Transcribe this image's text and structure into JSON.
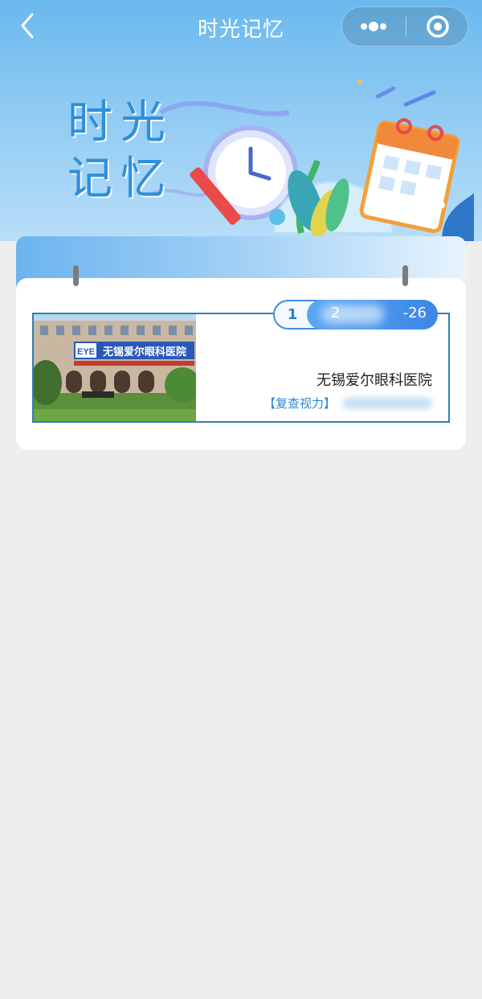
{
  "nav": {
    "title": "时光记忆",
    "back_icon": "chevron-left-icon",
    "more_icon": "more-dots-icon",
    "close_icon": "target-close-icon"
  },
  "hero": {
    "line1": "时光",
    "line2": "记忆"
  },
  "records": [
    {
      "index": "1",
      "date": "2",
      "date_end": "-26",
      "hospital": "无锡爱尔眼科医院",
      "tag": "【复查视力】",
      "photo_sign": "无锡爱尔眼科医院",
      "photo_logo": "EYE"
    }
  ],
  "colors": {
    "accent": "#3d86e6",
    "title": "#2f8fd8",
    "background": "#eeeeee"
  }
}
